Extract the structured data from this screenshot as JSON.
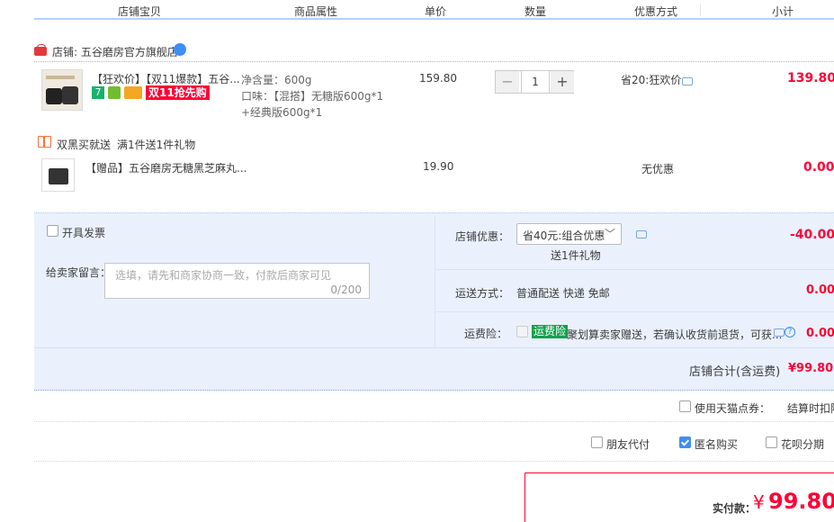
{
  "header": {
    "col_item": "店铺宝贝",
    "col_attr": "商品属性",
    "col_price": "单价",
    "col_qty": "数量",
    "col_discount": "优惠方式",
    "col_subtotal": "小计"
  },
  "shop": {
    "badge_text": "天猫",
    "label": "店铺: 五谷磨房官方旗舰店"
  },
  "item1": {
    "title": "【狂欢价】【双11爆款】五谷...",
    "tag_promo": "双11抢先购",
    "attr_weight": "净含量：600g",
    "attr_flavor": "口味：【混搭】无糖版600g*1",
    "attr_flavor2": "+经典版600g*1",
    "unit_price": "159.80",
    "qty": "1",
    "qty_minus": "−",
    "qty_plus": "+",
    "discount": "省20:狂欢价",
    "subtotal": "139.80"
  },
  "gift_promo": {
    "name": "双黑买就送",
    "rule": "满1件送1件礼物"
  },
  "item2": {
    "title": "【赠品】五谷磨房无糖黑芝麻丸...",
    "unit_price": "19.90",
    "discount": "无优惠",
    "subtotal": "0.00"
  },
  "order_panel": {
    "invoice_label": "开具发票",
    "message_label": "给卖家留言：",
    "message_placeholder": "选填，请先和商家协商一致，付款后商家可见",
    "message_counter": "0/200",
    "shop_discount_label": "店铺优惠：",
    "shop_discount_value": "省40元:组合优惠",
    "shop_discount_sub": "送1件礼物",
    "shop_discount_amount": "-40.00",
    "shipping_label": "运送方式：",
    "shipping_value": "普通配送 快递 免邮",
    "shipping_amount": "0.00",
    "insurance_label": "运费险：",
    "insurance_badge": "运费险",
    "insurance_text": "聚划算卖家赠送，若确认收货前退货，可获...",
    "insurance_amount": "0.00",
    "total_label": "店铺合计(含运费)",
    "total_amount": "¥99.80"
  },
  "tmall_points": {
    "label": "使用天猫点券：",
    "note": "结算时扣除"
  },
  "options": {
    "friend_pay": "朋友代付",
    "anonymous": "匿名购买",
    "huabei": "花呗分期"
  },
  "payment": {
    "label": "实付款：",
    "currency": "¥",
    "amount": "99.80"
  },
  "colors": {
    "accent_red": "#ff0036",
    "accent_blue": "#3d8ff4",
    "panel_bg": "#eaf1fd",
    "insurance_green": "#12a14b"
  }
}
